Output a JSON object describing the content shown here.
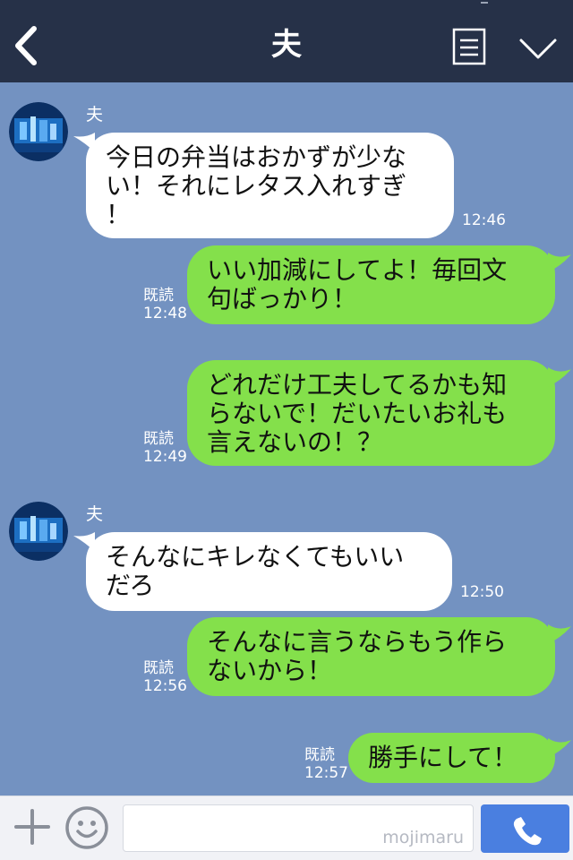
{
  "header": {
    "title": "夫"
  },
  "messages": [
    {
      "sender": "夫",
      "lines": [
        "今日の弁当はおかずが少な",
        "い！それにレタス入れすぎ",
        "！"
      ],
      "time": "12:46"
    },
    {
      "read": "既読",
      "time": "12:48",
      "lines": [
        "いい加減にしてよ！毎回文",
        "句ばっかり！"
      ]
    },
    {
      "read": "既読",
      "time": "12:49",
      "lines": [
        "どれだけ工夫してるかも知",
        "らないで！だいたいお礼も",
        "言えないの！？"
      ]
    },
    {
      "sender": "夫",
      "lines": [
        "そんなにキレなくてもいい",
        "だろ"
      ],
      "time": "12:50"
    },
    {
      "read": "既読",
      "time": "12:56",
      "lines": [
        "そんなに言うならもう作ら",
        "ないから！"
      ]
    },
    {
      "read": "既読",
      "time": "12:57",
      "lines": [
        "勝手にして！"
      ]
    }
  ],
  "input": {
    "watermark": "mojimaru"
  },
  "colors": {
    "header_bg": "#263148",
    "chat_bg": "#7392c1",
    "incoming_bubble": "#ffffff",
    "outgoing_bubble": "#84e04b",
    "call_button": "#4a7fe0"
  },
  "icons": {
    "back": "chevron-left-icon",
    "menu": "notes-icon",
    "collapse": "chevron-down-icon",
    "add": "plus-icon",
    "emoji": "smiley-icon",
    "call": "phone-icon"
  }
}
